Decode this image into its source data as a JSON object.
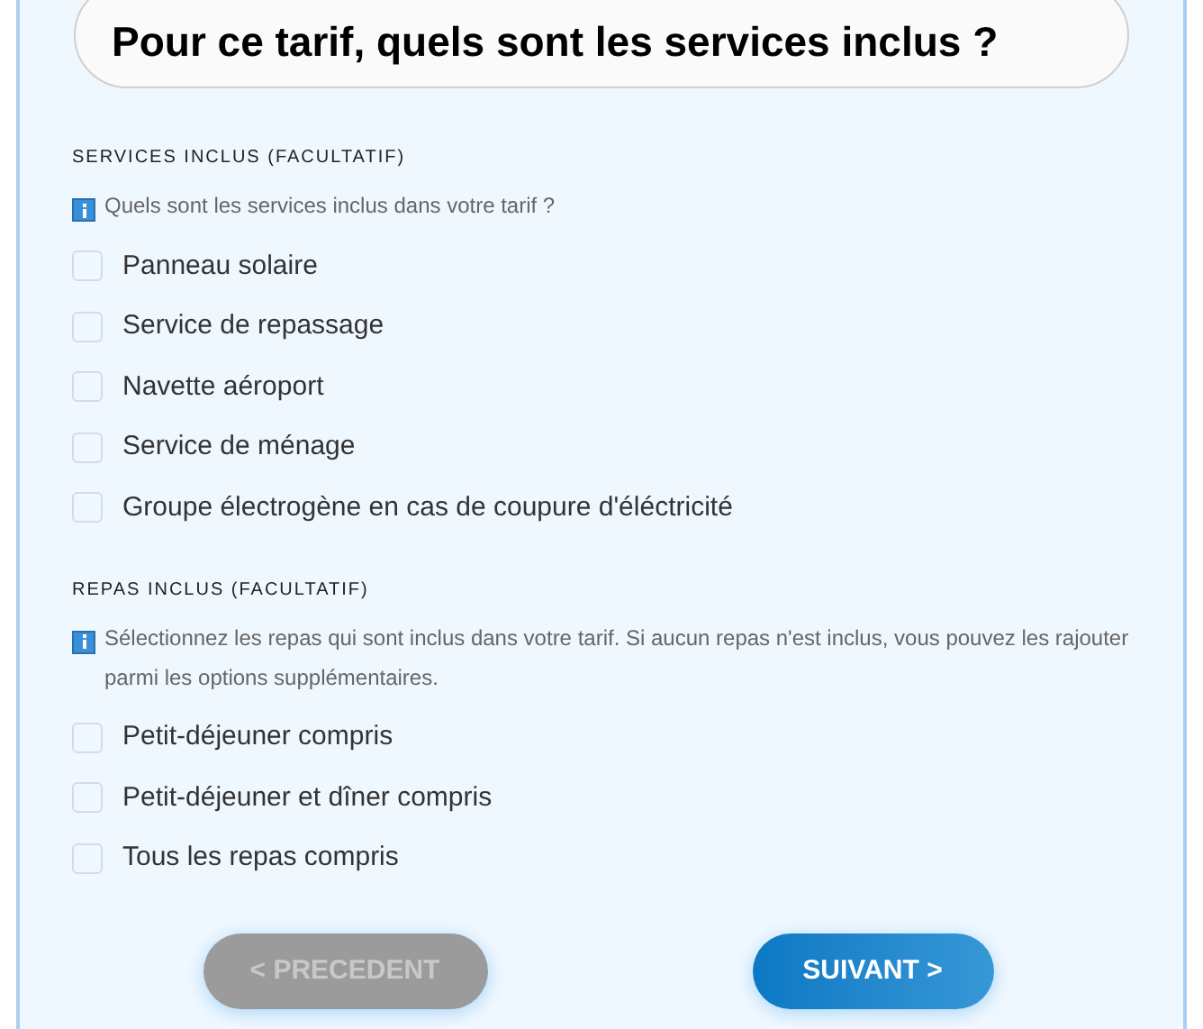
{
  "title": "Pour ce tarif, quels sont les services inclus ?",
  "sections": [
    {
      "heading": "SERVICES INCLUS (FACULTATIF)",
      "hint": "Quels sont les services inclus dans votre tarif ?",
      "options": [
        {
          "label": "Panneau solaire",
          "checked": false
        },
        {
          "label": "Service de repassage",
          "checked": false
        },
        {
          "label": "Navette aéroport",
          "checked": false
        },
        {
          "label": "Service de ménage",
          "checked": false
        },
        {
          "label": "Groupe électrogène en cas de coupure d'éléctricité",
          "checked": false
        }
      ]
    },
    {
      "heading": "REPAS INCLUS (FACULTATIF)",
      "hint": "Sélectionnez les repas qui sont inclus dans votre tarif. Si aucun repas n'est inclus, vous pouvez les rajouter parmi les options supplémentaires.",
      "options": [
        {
          "label": "Petit-déjeuner compris",
          "checked": false
        },
        {
          "label": "Petit-déjeuner et dîner compris",
          "checked": false
        },
        {
          "label": "Tous les repas compris",
          "checked": false
        }
      ]
    }
  ],
  "buttons": [
    {
      "label": "< PRECEDENT",
      "disabled": true
    },
    {
      "label": "SUIVANT >",
      "disabled": false
    }
  ]
}
